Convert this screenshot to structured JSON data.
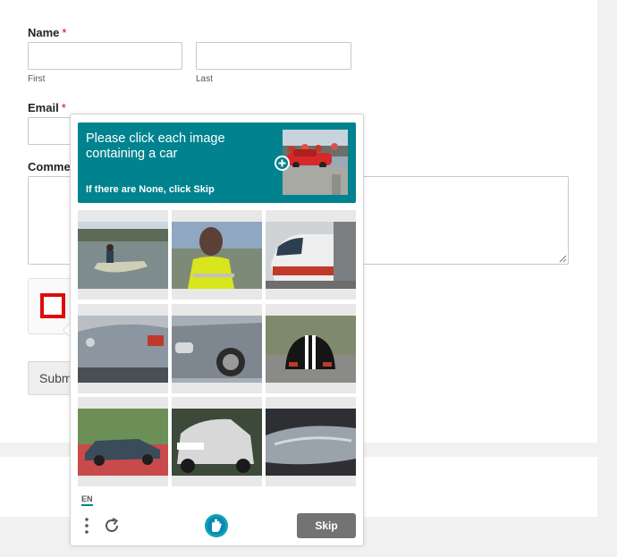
{
  "form": {
    "name_label": "Name",
    "required_mark": "*",
    "first_sublabel": "First",
    "last_sublabel": "Last",
    "email_label": "Email",
    "comment_label": "Comme",
    "submit_label": "Subm"
  },
  "captcha": {
    "prompt": "Please click each image containing a car",
    "hint": "If there are None, click Skip",
    "language": "EN",
    "skip_label": "Skip",
    "accent_color": "#00838f",
    "checkbox_color": "#e00a0a",
    "tiles": [
      "tile-boat",
      "tile-person-vest",
      "tile-train",
      "tile-car-rear-silver",
      "tile-car-side-dented",
      "tile-car-black-stripes",
      "tile-car-blue-lawn",
      "tile-car-white",
      "tile-car-silver-closeup"
    ]
  },
  "icons": {
    "menu": "menu-dots-icon",
    "refresh": "refresh-icon",
    "logo": "hcaptcha-logo-icon",
    "add": "plus-circle-icon"
  }
}
